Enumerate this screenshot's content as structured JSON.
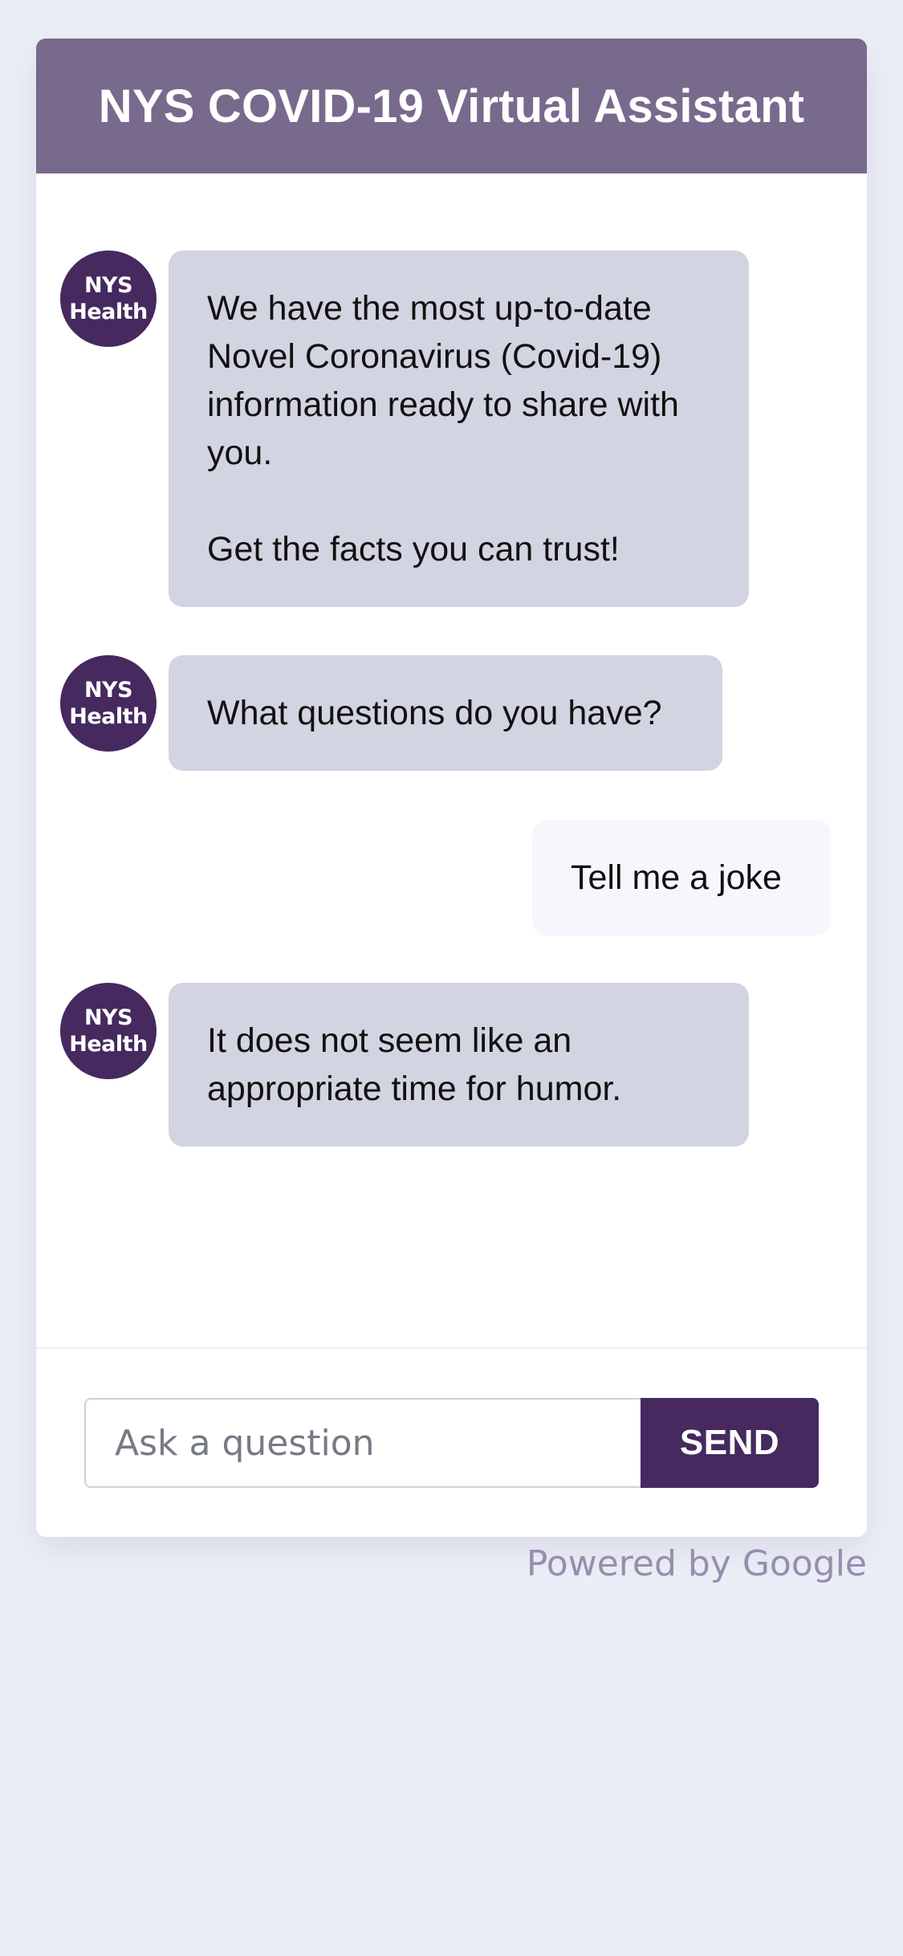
{
  "app": {
    "title": "NYS COVID-19 Virtual Assistant",
    "brand_color": "#776a8c",
    "accent_color": "#45295f",
    "background_color": "#eceef7"
  },
  "avatar": {
    "text": "NYS\nHealth",
    "icon": "nys-health-logo"
  },
  "messages": [
    {
      "sender": "bot",
      "text": "We have the most up-to-date\nNovel Coronavirus (Covid-19)\ninformation ready to share with\nyou.\n\nGet the facts you can trust!"
    },
    {
      "sender": "bot",
      "text": "What questions do you have?"
    },
    {
      "sender": "user",
      "text": "Tell me a joke"
    },
    {
      "sender": "bot",
      "text": "It does not seem like an\nappropriate time for humor."
    }
  ],
  "composer": {
    "placeholder": "Ask a question",
    "value": "",
    "send_label": "SEND"
  },
  "footer": {
    "powered_by": "Powered by Google"
  }
}
